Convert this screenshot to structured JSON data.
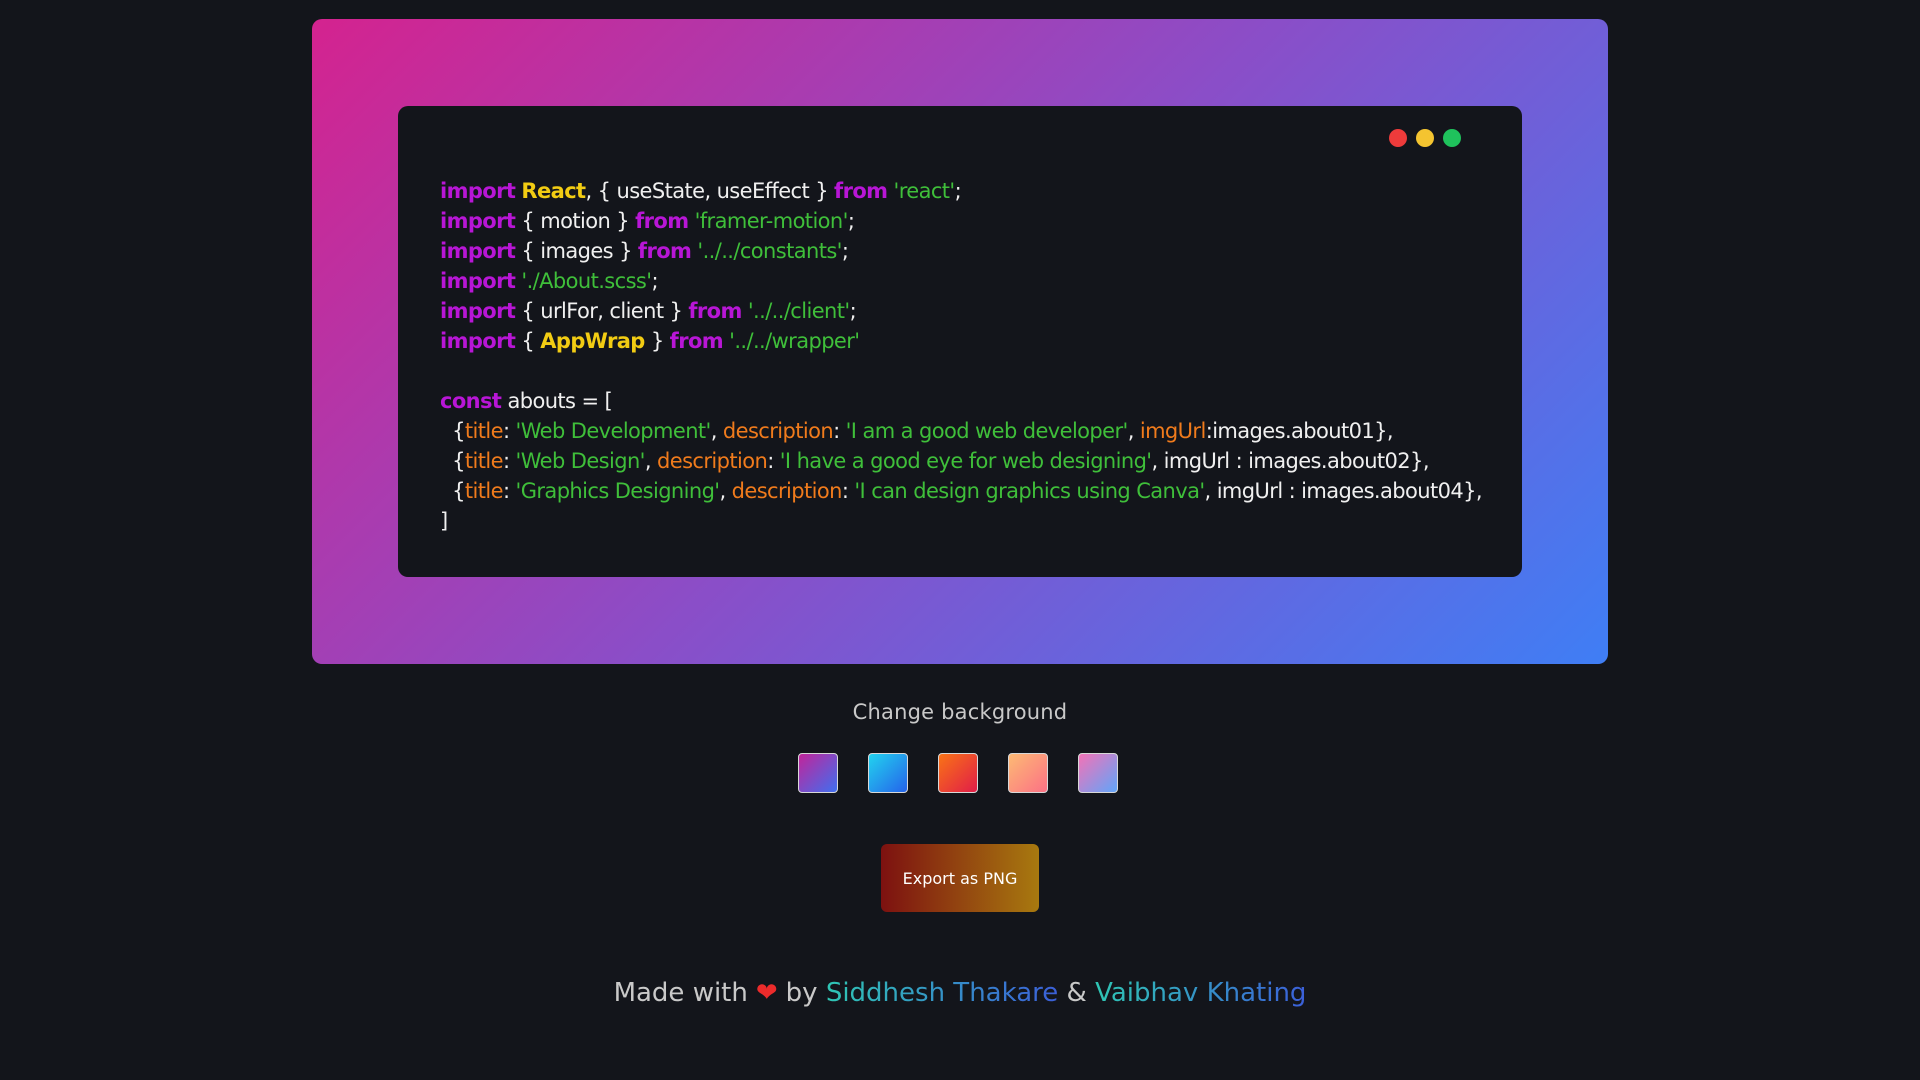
{
  "colors": {
    "page_bg": "#13151b",
    "frame_gradient": [
      "#d4238f",
      "#8a4ec8",
      "#3f7ef5"
    ],
    "keyword": "#b816d6",
    "component": "#f2cc13",
    "string": "#3fbf3a",
    "property": "#f07b1c",
    "window_dots": [
      "#ee3b3b",
      "#f4c430",
      "#1fc25c"
    ]
  },
  "code_lines": [
    [
      [
        "kw",
        "import"
      ],
      [
        "p",
        " "
      ],
      [
        "comp",
        "React"
      ],
      [
        "p",
        ", { useState, useEffect } "
      ],
      [
        "kw",
        "from"
      ],
      [
        "p",
        " "
      ],
      [
        "str",
        "'react'"
      ],
      [
        "p",
        ";"
      ]
    ],
    [
      [
        "kw",
        "import"
      ],
      [
        "p",
        " { motion } "
      ],
      [
        "kw",
        "from"
      ],
      [
        "p",
        " "
      ],
      [
        "str",
        "'framer-motion'"
      ],
      [
        "p",
        ";"
      ]
    ],
    [
      [
        "kw",
        "import"
      ],
      [
        "p",
        " { images } "
      ],
      [
        "kw",
        "from"
      ],
      [
        "p",
        " "
      ],
      [
        "str",
        "'../../constants'"
      ],
      [
        "p",
        ";"
      ]
    ],
    [
      [
        "kw",
        "import"
      ],
      [
        "p",
        " "
      ],
      [
        "str",
        "'./About.scss'"
      ],
      [
        "p",
        ";"
      ]
    ],
    [
      [
        "kw",
        "import"
      ],
      [
        "p",
        " { urlFor, client } "
      ],
      [
        "kw",
        "from"
      ],
      [
        "p",
        " "
      ],
      [
        "str",
        "'../../client'"
      ],
      [
        "p",
        ";"
      ]
    ],
    [
      [
        "kw",
        "import"
      ],
      [
        "p",
        " { "
      ],
      [
        "comp",
        "AppWrap"
      ],
      [
        "p",
        " } "
      ],
      [
        "kw",
        "from"
      ],
      [
        "p",
        " "
      ],
      [
        "str",
        "'../../wrapper'"
      ]
    ],
    [],
    [
      [
        "kw",
        "const"
      ],
      [
        "p",
        " abouts = ["
      ]
    ],
    [
      [
        "p",
        "  {"
      ],
      [
        "prop",
        "title"
      ],
      [
        "p",
        ": "
      ],
      [
        "str",
        "'Web Development'"
      ],
      [
        "p",
        ", "
      ],
      [
        "prop",
        "description"
      ],
      [
        "p",
        ": "
      ],
      [
        "str",
        "'I am a good web developer'"
      ],
      [
        "p",
        ", "
      ],
      [
        "prop",
        "imgUrl"
      ],
      [
        "p",
        ":images.about01},"
      ]
    ],
    [
      [
        "p",
        "  {"
      ],
      [
        "prop",
        "title"
      ],
      [
        "p",
        ": "
      ],
      [
        "str",
        "'Web Design'"
      ],
      [
        "p",
        ", "
      ],
      [
        "prop",
        "description"
      ],
      [
        "p",
        ": "
      ],
      [
        "str",
        "'I have a good eye for web designing'"
      ],
      [
        "p",
        ", imgUrl : images.about02},"
      ]
    ],
    [
      [
        "p",
        "  {"
      ],
      [
        "prop",
        "title"
      ],
      [
        "p",
        ": "
      ],
      [
        "str",
        "'Graphics Designing'"
      ],
      [
        "p",
        ", "
      ],
      [
        "prop",
        "description"
      ],
      [
        "p",
        ": "
      ],
      [
        "str",
        "'I can design graphics using Canva'"
      ],
      [
        "p",
        ", imgUrl : images.about04},"
      ]
    ],
    [
      [
        "p",
        "]"
      ]
    ]
  ],
  "background_picker": {
    "label": "Change background",
    "swatches": [
      {
        "name": "purple-blue",
        "from": "#c2249a",
        "to": "#3f6ff0"
      },
      {
        "name": "cyan-blue",
        "from": "#22d3ee",
        "to": "#2563eb"
      },
      {
        "name": "orange-red",
        "from": "#f97316",
        "to": "#e11d48"
      },
      {
        "name": "peach",
        "from": "#fdba74",
        "to": "#fb7185"
      },
      {
        "name": "pink-blue",
        "from": "#f472b6",
        "to": "#60a5fa"
      }
    ]
  },
  "export": {
    "label": "Export as PNG"
  },
  "footer": {
    "prefix": "Made with",
    "heart": "❤",
    "by": "by",
    "author1": "Siddhesh Thakare",
    "amp": "&",
    "author2": "Vaibhav Khating"
  }
}
